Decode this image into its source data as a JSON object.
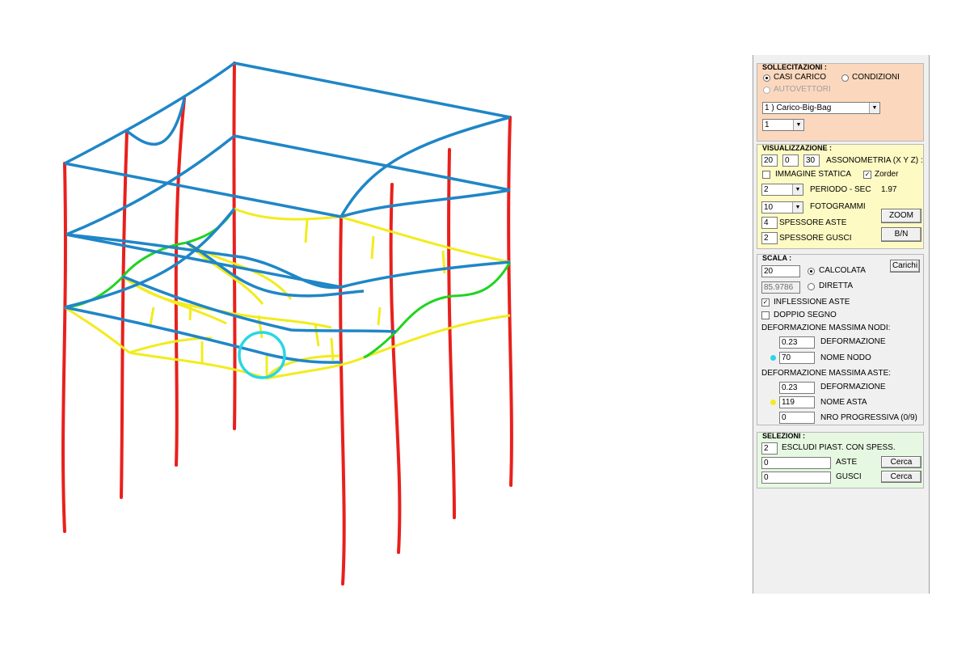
{
  "colors": {
    "columns": "#e8201c",
    "beams": "#1f86c7",
    "shell_yellow": "#f2ec1d",
    "shell_green": "#1fd41f",
    "selection_circle": "#28d7e6",
    "sollecitazioni_bg": "#fbd8bd",
    "visualizzazione_bg": "#fdfac3",
    "selezioni_bg": "#e6f8e1"
  },
  "sollecitazioni": {
    "title": "SOLLECITAZIONI :",
    "casi_carico": "CASI CARICO",
    "condizioni": "CONDIZIONI",
    "autovettori": "AUTOVETTORI",
    "case_selected": "1 ) Carico-Big-Bag",
    "num_selected": "1"
  },
  "visualizzazione": {
    "title": "VISUALIZZAZIONE :",
    "axo_x": "20",
    "axo_y": "0",
    "axo_z": "30",
    "assonometria_label": "ASSONOMETRIA (X Y Z) :",
    "immagine_statica": "IMMAGINE STATICA",
    "zorder": "Zorder",
    "periodo_value": "2",
    "periodo_label": "PERIODO - SEC",
    "periodo_result": "1.97",
    "fotogrammi_value": "10",
    "fotogrammi_label": "FOTOGRAMMI",
    "spessore_aste_value": "4",
    "spessore_aste_label": "SPESSORE ASTE",
    "spessore_gusci_value": "2",
    "spessore_gusci_label": "SPESSORE GUSCI",
    "zoom_button": "ZOOM",
    "bn_button": "B/N"
  },
  "scala": {
    "title": "SCALA :",
    "calcolata_value": "20",
    "calcolata_label": "CALCOLATA",
    "diretta_value": "85.9786",
    "diretta_label": "DIRETTA",
    "carichi_button": "Carichi",
    "inflessione_aste": "INFLESSIONE ASTE",
    "doppio_segno": "DOPPIO SEGNO",
    "def_max_nodi": "DEFORMAZIONE MASSIMA NODI:",
    "nodi_def_value": "0.23",
    "nodi_def_label": "DEFORMAZIONE",
    "nodi_nome_value": "70",
    "nodi_nome_label": "NOME NODO",
    "def_max_aste": "DEFORMAZIONE MASSIMA ASTE:",
    "aste_def_value": "0.23",
    "aste_def_label": "DEFORMAZIONE",
    "aste_nome_value": "119",
    "aste_nome_label": "NOME ASTA",
    "nro_value": "0",
    "nro_label": "NRO PROGRESSIVA (0/9)"
  },
  "selezioni": {
    "title": "SELEZIONI :",
    "escludi_value": "2",
    "escludi_label": "ESCLUDI PIAST. CON SPESS.",
    "aste_value": "0",
    "aste_label": "ASTE",
    "gusci_value": "0",
    "gusci_label": "GUSCI",
    "cerca_button": "Cerca"
  }
}
